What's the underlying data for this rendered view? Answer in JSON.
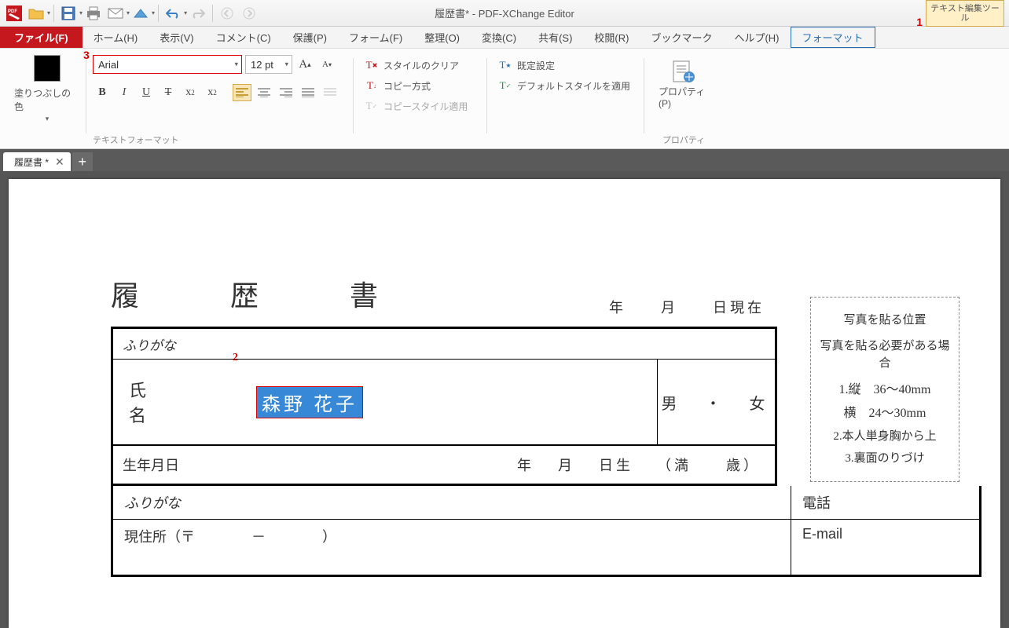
{
  "app_title": "履歴書* - PDF-XChange Editor",
  "text_tool_label": "テキスト編集ツール",
  "callouts": {
    "c1": "1",
    "c2": "2",
    "c3": "3"
  },
  "menu": {
    "file": "ファイル(F)",
    "home": "ホーム(H)",
    "view": "表示(V)",
    "comment": "コメント(C)",
    "protect": "保護(P)",
    "form": "フォーム(F)",
    "organize": "整理(O)",
    "convert": "変換(C)",
    "share": "共有(S)",
    "review": "校閲(R)",
    "bookmark": "ブックマーク",
    "help": "ヘルプ(H)",
    "format": "フォーマット"
  },
  "ribbon": {
    "fill_label": "塗りつぶしの色",
    "font_name": "Arial",
    "font_size": "12 pt",
    "group_textfmt": "テキストフォーマット",
    "group_prop": "プロパティ",
    "style_clear": "スタイルのクリア",
    "copy_method": "コピー方式",
    "copy_style": "コピースタイル適用",
    "default_setting": "既定設定",
    "default_style": "デフォルトスタイルを適用",
    "properties": "プロパティ(P)"
  },
  "tab": {
    "name": "履歴書 *"
  },
  "doc": {
    "title": "履　歴　書",
    "date_year": "年",
    "date_month": "月",
    "date_suffix": "日現在",
    "furigana": "ふりがな",
    "name_label": "氏　名",
    "name_value": "森野  花子",
    "gender": "男　・　女",
    "birth_label": "生年月日",
    "birth_year": "年",
    "birth_month": "月",
    "birth_day": "日生",
    "birth_age_open": "（満",
    "birth_age_close": "歳）",
    "addr_label": "現住所（〒",
    "addr_dash": "－",
    "addr_close": "）",
    "phone": "電話",
    "email": "E-mail",
    "photo": {
      "title": "写真を貼る位置",
      "line1": "写真を貼る必要がある場合",
      "d1": "1.縦　36～40mm",
      "d2": "横　24～30mm",
      "d3": "2.本人単身胸から上",
      "d4": "3.裏面のりづけ"
    }
  }
}
